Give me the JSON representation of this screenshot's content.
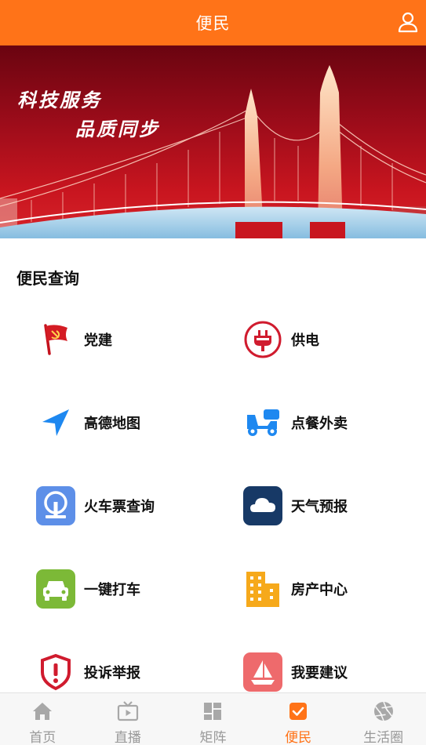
{
  "header": {
    "title": "便民",
    "user_icon": "user-icon"
  },
  "banner": {
    "slogan_line1": "科技服务",
    "slogan_line2": "品质同步"
  },
  "section": {
    "title": "便民查询",
    "items": [
      {
        "label": "党建",
        "icon": "party-flag-icon"
      },
      {
        "label": "供电",
        "icon": "power-plug-icon"
      },
      {
        "label": "高德地图",
        "icon": "navigation-arrow-icon"
      },
      {
        "label": "点餐外卖",
        "icon": "delivery-scooter-icon"
      },
      {
        "label": "火车票查询",
        "icon": "railway-logo-icon"
      },
      {
        "label": "天气预报",
        "icon": "cloud-icon"
      },
      {
        "label": "一键打车",
        "icon": "car-icon"
      },
      {
        "label": "房产中心",
        "icon": "building-icon"
      },
      {
        "label": "投诉举报",
        "icon": "warning-shield-icon"
      },
      {
        "label": "我要建议",
        "icon": "suggestion-boat-icon"
      }
    ]
  },
  "bottom_nav": {
    "active": "便民",
    "items": [
      {
        "label": "首页",
        "icon": "home-icon"
      },
      {
        "label": "直播",
        "icon": "tv-icon"
      },
      {
        "label": "矩阵",
        "icon": "grid-icon"
      },
      {
        "label": "便民",
        "icon": "checkbox-icon"
      },
      {
        "label": "生活圈",
        "icon": "aperture-icon"
      }
    ]
  },
  "colors": {
    "brand": "#ff7318",
    "inactive": "#999999"
  }
}
